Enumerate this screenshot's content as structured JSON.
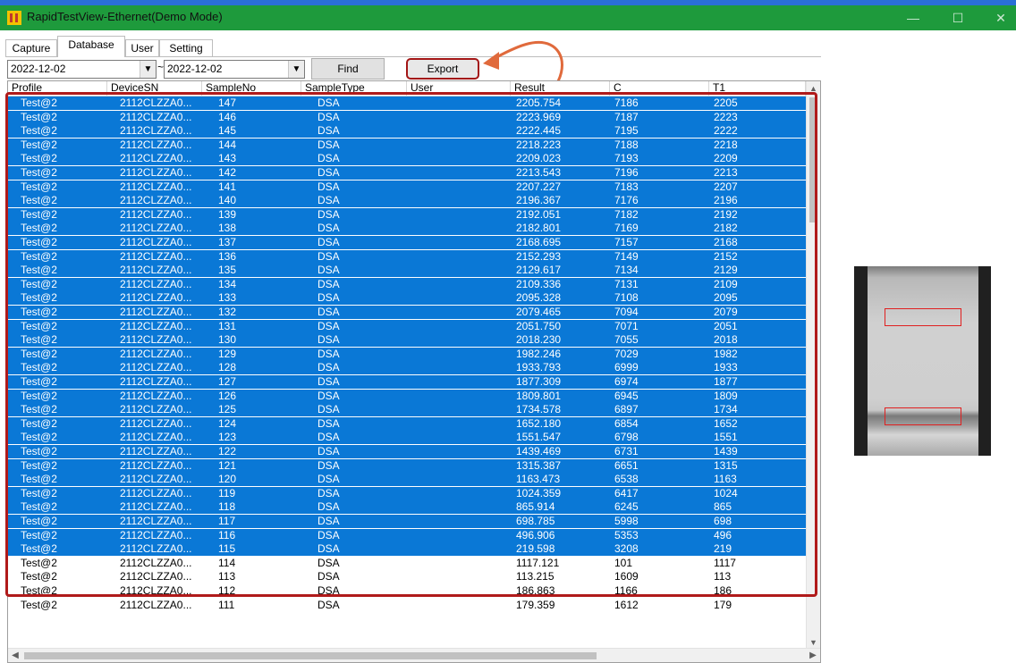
{
  "window": {
    "title": "RapidTestView-Ethernet(Demo Mode)",
    "minimize": "—",
    "maximize": "☐",
    "close": "✕"
  },
  "tabs": [
    {
      "label": "Capture",
      "active": false
    },
    {
      "label": "Database",
      "active": true
    },
    {
      "label": "User",
      "active": false
    },
    {
      "label": "Setting",
      "active": false
    }
  ],
  "filters": {
    "date_from": "2022-12-02",
    "separator": "~",
    "date_to": "2022-12-02",
    "find_label": "Find",
    "export_label": "Export"
  },
  "columns": [
    "Profile",
    "DeviceSN",
    "SampleNo",
    "SampleType",
    "User",
    "Result",
    "C",
    "T1"
  ],
  "rows": [
    {
      "profile": "Test@2",
      "sn": "2112CLZZA0...",
      "no": "147",
      "type": "DSA",
      "user": "",
      "result": "2205.754",
      "c": "7186",
      "t1": "2205",
      "selected": true
    },
    {
      "profile": "Test@2",
      "sn": "2112CLZZA0...",
      "no": "146",
      "type": "DSA",
      "user": "",
      "result": "2223.969",
      "c": "7187",
      "t1": "2223",
      "selected": true
    },
    {
      "profile": "Test@2",
      "sn": "2112CLZZA0...",
      "no": "145",
      "type": "DSA",
      "user": "",
      "result": "2222.445",
      "c": "7195",
      "t1": "2222",
      "selected": true
    },
    {
      "profile": "Test@2",
      "sn": "2112CLZZA0...",
      "no": "144",
      "type": "DSA",
      "user": "",
      "result": "2218.223",
      "c": "7188",
      "t1": "2218",
      "selected": true
    },
    {
      "profile": "Test@2",
      "sn": "2112CLZZA0...",
      "no": "143",
      "type": "DSA",
      "user": "",
      "result": "2209.023",
      "c": "7193",
      "t1": "2209",
      "selected": true
    },
    {
      "profile": "Test@2",
      "sn": "2112CLZZA0...",
      "no": "142",
      "type": "DSA",
      "user": "",
      "result": "2213.543",
      "c": "7196",
      "t1": "2213",
      "selected": true
    },
    {
      "profile": "Test@2",
      "sn": "2112CLZZA0...",
      "no": "141",
      "type": "DSA",
      "user": "",
      "result": "2207.227",
      "c": "7183",
      "t1": "2207",
      "selected": true
    },
    {
      "profile": "Test@2",
      "sn": "2112CLZZA0...",
      "no": "140",
      "type": "DSA",
      "user": "",
      "result": "2196.367",
      "c": "7176",
      "t1": "2196",
      "selected": true
    },
    {
      "profile": "Test@2",
      "sn": "2112CLZZA0...",
      "no": "139",
      "type": "DSA",
      "user": "",
      "result": "2192.051",
      "c": "7182",
      "t1": "2192",
      "selected": true
    },
    {
      "profile": "Test@2",
      "sn": "2112CLZZA0...",
      "no": "138",
      "type": "DSA",
      "user": "",
      "result": "2182.801",
      "c": "7169",
      "t1": "2182",
      "selected": true
    },
    {
      "profile": "Test@2",
      "sn": "2112CLZZA0...",
      "no": "137",
      "type": "DSA",
      "user": "",
      "result": "2168.695",
      "c": "7157",
      "t1": "2168",
      "selected": true
    },
    {
      "profile": "Test@2",
      "sn": "2112CLZZA0...",
      "no": "136",
      "type": "DSA",
      "user": "",
      "result": "2152.293",
      "c": "7149",
      "t1": "2152",
      "selected": true
    },
    {
      "profile": "Test@2",
      "sn": "2112CLZZA0...",
      "no": "135",
      "type": "DSA",
      "user": "",
      "result": "2129.617",
      "c": "7134",
      "t1": "2129",
      "selected": true
    },
    {
      "profile": "Test@2",
      "sn": "2112CLZZA0...",
      "no": "134",
      "type": "DSA",
      "user": "",
      "result": "2109.336",
      "c": "7131",
      "t1": "2109",
      "selected": true
    },
    {
      "profile": "Test@2",
      "sn": "2112CLZZA0...",
      "no": "133",
      "type": "DSA",
      "user": "",
      "result": "2095.328",
      "c": "7108",
      "t1": "2095",
      "selected": true
    },
    {
      "profile": "Test@2",
      "sn": "2112CLZZA0...",
      "no": "132",
      "type": "DSA",
      "user": "",
      "result": "2079.465",
      "c": "7094",
      "t1": "2079",
      "selected": true
    },
    {
      "profile": "Test@2",
      "sn": "2112CLZZA0...",
      "no": "131",
      "type": "DSA",
      "user": "",
      "result": "2051.750",
      "c": "7071",
      "t1": "2051",
      "selected": true
    },
    {
      "profile": "Test@2",
      "sn": "2112CLZZA0...",
      "no": "130",
      "type": "DSA",
      "user": "",
      "result": "2018.230",
      "c": "7055",
      "t1": "2018",
      "selected": true
    },
    {
      "profile": "Test@2",
      "sn": "2112CLZZA0...",
      "no": "129",
      "type": "DSA",
      "user": "",
      "result": "1982.246",
      "c": "7029",
      "t1": "1982",
      "selected": true
    },
    {
      "profile": "Test@2",
      "sn": "2112CLZZA0...",
      "no": "128",
      "type": "DSA",
      "user": "",
      "result": "1933.793",
      "c": "6999",
      "t1": "1933",
      "selected": true
    },
    {
      "profile": "Test@2",
      "sn": "2112CLZZA0...",
      "no": "127",
      "type": "DSA",
      "user": "",
      "result": "1877.309",
      "c": "6974",
      "t1": "1877",
      "selected": true
    },
    {
      "profile": "Test@2",
      "sn": "2112CLZZA0...",
      "no": "126",
      "type": "DSA",
      "user": "",
      "result": "1809.801",
      "c": "6945",
      "t1": "1809",
      "selected": true
    },
    {
      "profile": "Test@2",
      "sn": "2112CLZZA0...",
      "no": "125",
      "type": "DSA",
      "user": "",
      "result": "1734.578",
      "c": "6897",
      "t1": "1734",
      "selected": true
    },
    {
      "profile": "Test@2",
      "sn": "2112CLZZA0...",
      "no": "124",
      "type": "DSA",
      "user": "",
      "result": "1652.180",
      "c": "6854",
      "t1": "1652",
      "selected": true
    },
    {
      "profile": "Test@2",
      "sn": "2112CLZZA0...",
      "no": "123",
      "type": "DSA",
      "user": "",
      "result": "1551.547",
      "c": "6798",
      "t1": "1551",
      "selected": true
    },
    {
      "profile": "Test@2",
      "sn": "2112CLZZA0...",
      "no": "122",
      "type": "DSA",
      "user": "",
      "result": "1439.469",
      "c": "6731",
      "t1": "1439",
      "selected": true
    },
    {
      "profile": "Test@2",
      "sn": "2112CLZZA0...",
      "no": "121",
      "type": "DSA",
      "user": "",
      "result": "1315.387",
      "c": "6651",
      "t1": "1315",
      "selected": true
    },
    {
      "profile": "Test@2",
      "sn": "2112CLZZA0...",
      "no": "120",
      "type": "DSA",
      "user": "",
      "result": "1163.473",
      "c": "6538",
      "t1": "1163",
      "selected": true
    },
    {
      "profile": "Test@2",
      "sn": "2112CLZZA0...",
      "no": "119",
      "type": "DSA",
      "user": "",
      "result": "1024.359",
      "c": "6417",
      "t1": "1024",
      "selected": true
    },
    {
      "profile": "Test@2",
      "sn": "2112CLZZA0...",
      "no": "118",
      "type": "DSA",
      "user": "",
      "result": "865.914",
      "c": "6245",
      "t1": "865",
      "selected": true
    },
    {
      "profile": "Test@2",
      "sn": "2112CLZZA0...",
      "no": "117",
      "type": "DSA",
      "user": "",
      "result": "698.785",
      "c": "5998",
      "t1": "698",
      "selected": true
    },
    {
      "profile": "Test@2",
      "sn": "2112CLZZA0...",
      "no": "116",
      "type": "DSA",
      "user": "",
      "result": "496.906",
      "c": "5353",
      "t1": "496",
      "selected": true
    },
    {
      "profile": "Test@2",
      "sn": "2112CLZZA0...",
      "no": "115",
      "type": "DSA",
      "user": "",
      "result": "219.598",
      "c": "3208",
      "t1": "219",
      "selected": true
    },
    {
      "profile": "Test@2",
      "sn": "2112CLZZA0...",
      "no": "114",
      "type": "DSA",
      "user": "",
      "result": "1117.121",
      "c": "101",
      "t1": "1117",
      "selected": false
    },
    {
      "profile": "Test@2",
      "sn": "2112CLZZA0...",
      "no": "113",
      "type": "DSA",
      "user": "",
      "result": "113.215",
      "c": "1609",
      "t1": "113",
      "selected": false
    },
    {
      "profile": "Test@2",
      "sn": "2112CLZZA0...",
      "no": "112",
      "type": "DSA",
      "user": "",
      "result": "186.863",
      "c": "1166",
      "t1": "186",
      "selected": false
    },
    {
      "profile": "Test@2",
      "sn": "2112CLZZA0...",
      "no": "111",
      "type": "DSA",
      "user": "",
      "result": "179.359",
      "c": "1612",
      "t1": "179",
      "selected": false
    }
  ],
  "colors": {
    "title_bar": "#1e9a3c",
    "selection": "#0a78d6",
    "annotation": "#b01a1a"
  },
  "icons": {
    "app": "app-icon",
    "dropdown": "chevron-down-icon",
    "arrow": "annotation-arrow"
  }
}
